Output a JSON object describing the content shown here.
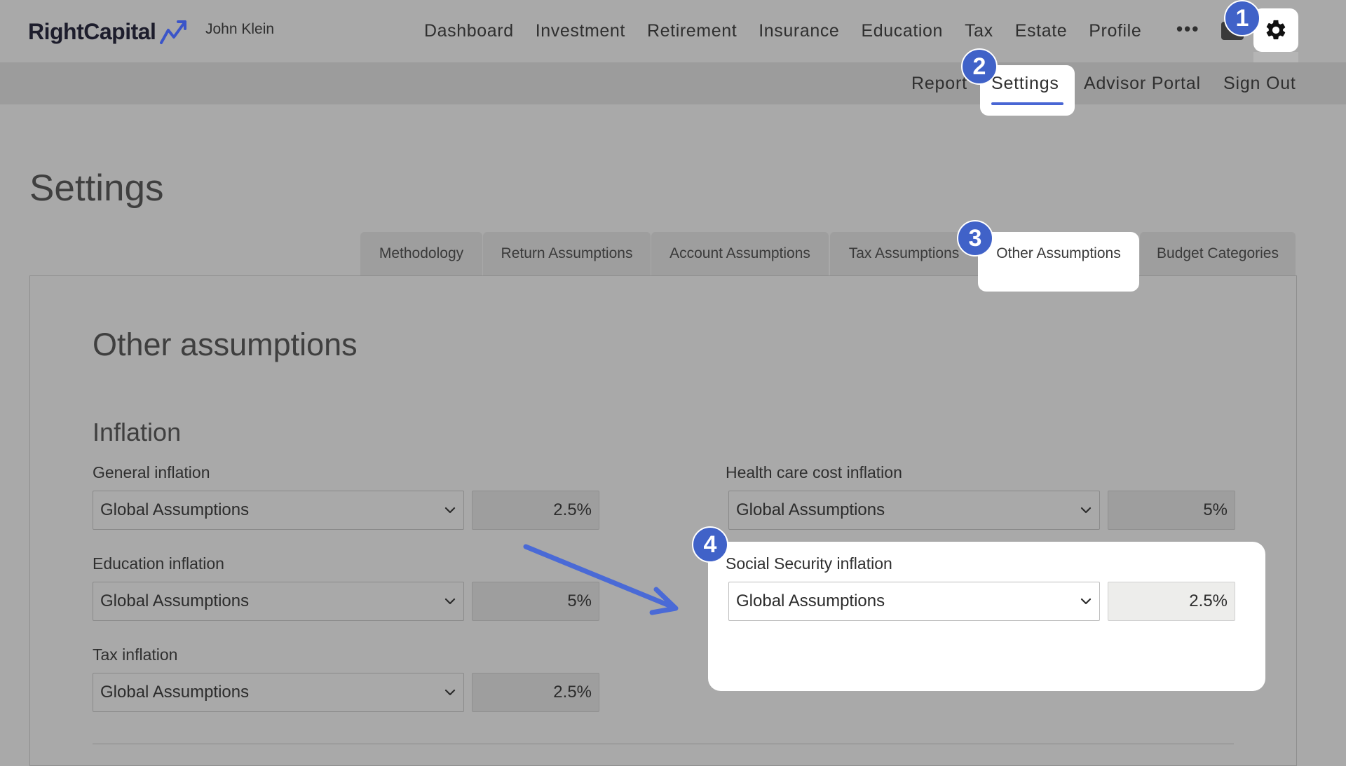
{
  "app": {
    "brand": "RightCapital",
    "user_name": "John Klein"
  },
  "main_nav": [
    "Dashboard",
    "Investment",
    "Retirement",
    "Insurance",
    "Education",
    "Tax",
    "Estate",
    "Profile"
  ],
  "more_label": "•••",
  "sub_nav": {
    "report": "Report",
    "settings": "Settings",
    "advisor_portal": "Advisor Portal",
    "sign_out": "Sign Out"
  },
  "page": {
    "title": "Settings"
  },
  "tabs": {
    "methodology": "Methodology",
    "return_assumptions": "Return Assumptions",
    "account_assumptions": "Account Assumptions",
    "tax_assumptions": "Tax Assumptions",
    "other_assumptions": "Other Assumptions",
    "budget_categories": "Budget Categories",
    "active": "Other Assumptions"
  },
  "section": {
    "title": "Other assumptions",
    "subheading": "Inflation"
  },
  "fields": {
    "general_inflation": {
      "label": "General inflation",
      "source": "Global Assumptions",
      "value": "2.5%"
    },
    "education_inflation": {
      "label": "Education inflation",
      "source": "Global Assumptions",
      "value": "5%"
    },
    "tax_inflation": {
      "label": "Tax inflation",
      "source": "Global Assumptions",
      "value": "2.5%"
    },
    "health_care_inflation": {
      "label": "Health care cost inflation",
      "source": "Global Assumptions",
      "value": "5%"
    },
    "social_security_inflation": {
      "label": "Social Security inflation",
      "source": "Global Assumptions",
      "value": "2.5%"
    }
  },
  "step_badges": [
    "1",
    "2",
    "3",
    "4"
  ],
  "icons": {
    "logo_mark": "trend-arrow-icon",
    "inbox": "inbox-icon",
    "settings": "gear-icon",
    "dropdown": "chevron-down-icon"
  },
  "colors": {
    "accent": "#4966d4",
    "badge": "#4062c8",
    "arrow": "#4a6ad6",
    "overlay": "#a9a9a9"
  }
}
